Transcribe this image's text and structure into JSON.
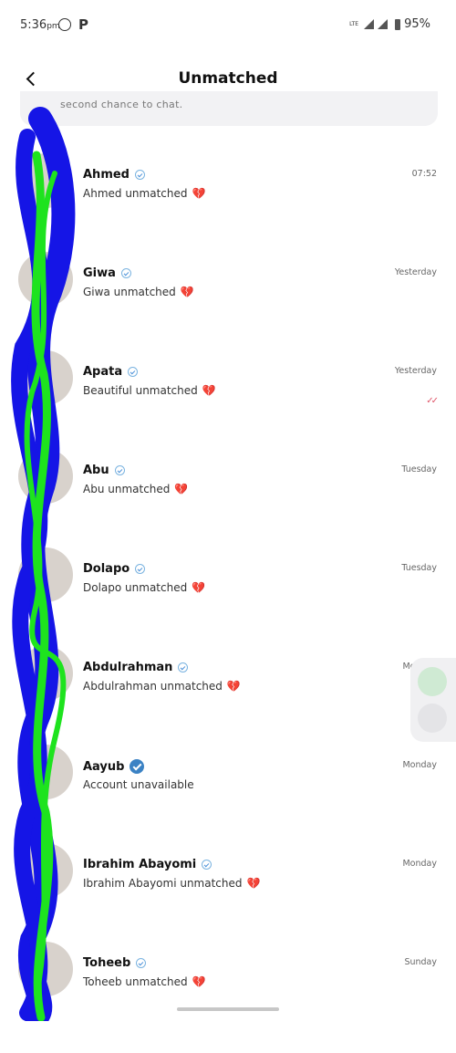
{
  "status_bar": {
    "time": "5:36",
    "ampm": "pm",
    "notif_letter": "P",
    "network": "LTE",
    "battery": "95%"
  },
  "header": {
    "title": "Unmatched"
  },
  "notice": {
    "text": "second chance to chat."
  },
  "chats": [
    {
      "name": "Ahmed",
      "message": "Ahmed unmatched",
      "time": "07:52",
      "heart": "💔"
    },
    {
      "name": "Giwa",
      "message": "Giwa unmatched",
      "time": "Yesterday",
      "heart": "💔"
    },
    {
      "name": "Apata",
      "message": "Beautiful unmatched",
      "time": "Yesterday",
      "heart": "💔",
      "ticks": "✓✓"
    },
    {
      "name": "Abu",
      "message": "Abu unmatched",
      "time": "Tuesday",
      "heart": "💔"
    },
    {
      "name": "Dolapo",
      "message": "Dolapo unmatched",
      "time": "Tuesday",
      "heart": "💔"
    },
    {
      "name": "Abdulrahman",
      "message": "Abdulrahman unmatched",
      "time": "Monday",
      "heart": "💔"
    },
    {
      "name": "Aayub",
      "message": "Account unavailable",
      "time": "Monday"
    },
    {
      "name": "Ibrahim Abayomi",
      "message": "Ibrahim Abayomi unmatched",
      "time": "Monday",
      "heart": "💔"
    },
    {
      "name": "Toheeb",
      "message": "Toheeb unmatched",
      "time": "Sunday",
      "heart": "💔"
    }
  ]
}
